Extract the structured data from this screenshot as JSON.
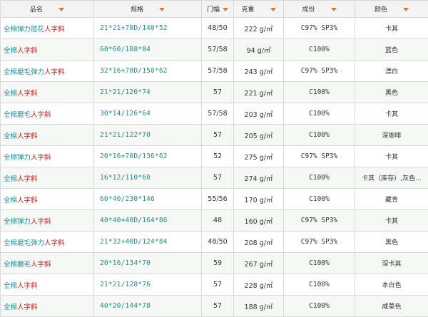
{
  "headers": [
    {
      "label": "品名"
    },
    {
      "label": "规格"
    },
    {
      "label": "门幅"
    },
    {
      "label": "克重"
    },
    {
      "label": "成份"
    },
    {
      "label": "颜色"
    }
  ],
  "rows": [
    {
      "name_prefix": "全棉弹力提花",
      "name_suffix": "人字斜",
      "spec": "21*21+70D/140*52",
      "width": "48/50",
      "weight": "222 g/㎡",
      "composition": "C97%  SP3%",
      "color": "卡其"
    },
    {
      "name_prefix": "全棉",
      "name_suffix": "人字斜",
      "spec": "60*60/188*84",
      "width": "57/58",
      "weight": "94 g/㎡",
      "composition": "C100%",
      "color": "蓝色"
    },
    {
      "name_prefix": "全棉磨毛弹力",
      "name_suffix": "人字斜",
      "spec": "32*16+70D/150*62",
      "width": "57/58",
      "weight": "243 g/㎡",
      "composition": "C97%  SP3%",
      "color": "漂白"
    },
    {
      "name_prefix": "全棉",
      "name_suffix": "人字斜",
      "spec": "21*21/120*74",
      "width": "57",
      "weight": "221 g/㎡",
      "composition": "C100%",
      "color": "黑色"
    },
    {
      "name_prefix": "全棉磨毛",
      "name_suffix": "人字斜",
      "spec": "30*14/126*64",
      "width": "57/58",
      "weight": "203 g/㎡",
      "composition": "C100%",
      "color": "卡其"
    },
    {
      "name_prefix": "全棉",
      "name_suffix": "人字斜",
      "spec": "21*21/122*70",
      "width": "57",
      "weight": "205 g/㎡",
      "composition": "C100%",
      "color": "深咖啡"
    },
    {
      "name_prefix": "全棉弹力",
      "name_suffix": "人字斜",
      "spec": "20*16+70D/136*62",
      "width": "52",
      "weight": "275 g/㎡",
      "composition": "C97%  SP3%",
      "color": "卡其"
    },
    {
      "name_prefix": "全棉",
      "name_suffix": "人字斜",
      "spec": "16*12/110*60",
      "width": "57",
      "weight": "274 g/㎡",
      "composition": "C100%",
      "color": "卡其（库存）,灰色..."
    },
    {
      "name_prefix": "全棉",
      "name_suffix": "人字斜",
      "spec": "60*40/230*146",
      "width": "55/56",
      "weight": "170 g/㎡",
      "composition": "C100%",
      "color": "藏青"
    },
    {
      "name_prefix": "全棉弹力",
      "name_suffix": "人字斜",
      "spec": "40*40+40D/164*86",
      "width": "48",
      "weight": "160 g/㎡",
      "composition": "C97%  SP3%",
      "color": "卡其"
    },
    {
      "name_prefix": "全棉磨毛弹力",
      "name_suffix": "人字斜",
      "spec": "21*32+40D/124*84",
      "width": "48/50",
      "weight": "208 g/㎡",
      "composition": "C97%  SP3%",
      "color": "黑色"
    },
    {
      "name_prefix": "全棉磨毛",
      "name_suffix": "人字斜",
      "spec": "20*16/134*70",
      "width": "59",
      "weight": "267 g/㎡",
      "composition": "C100%",
      "color": "深卡其"
    },
    {
      "name_prefix": "全棉",
      "name_suffix": "人字斜",
      "spec": "21*21/128*76",
      "width": "57",
      "weight": "228 g/㎡",
      "composition": "C100%",
      "color": "本白色"
    },
    {
      "name_prefix": "全棉",
      "name_suffix": "人字斜",
      "spec": "40*20/144*78",
      "width": "57",
      "weight": "188 g/㎡",
      "composition": "C100%",
      "color": "咸菜色"
    }
  ],
  "colors": {
    "name_prefix": "#1f8f8f",
    "name_suffix": "#cc1111",
    "sort_arrow": "#e8761e",
    "header_bg": "#f3f3f3",
    "border": "#d9d9d9"
  },
  "icons": {
    "sort": "sort-arrow-down-icon"
  }
}
